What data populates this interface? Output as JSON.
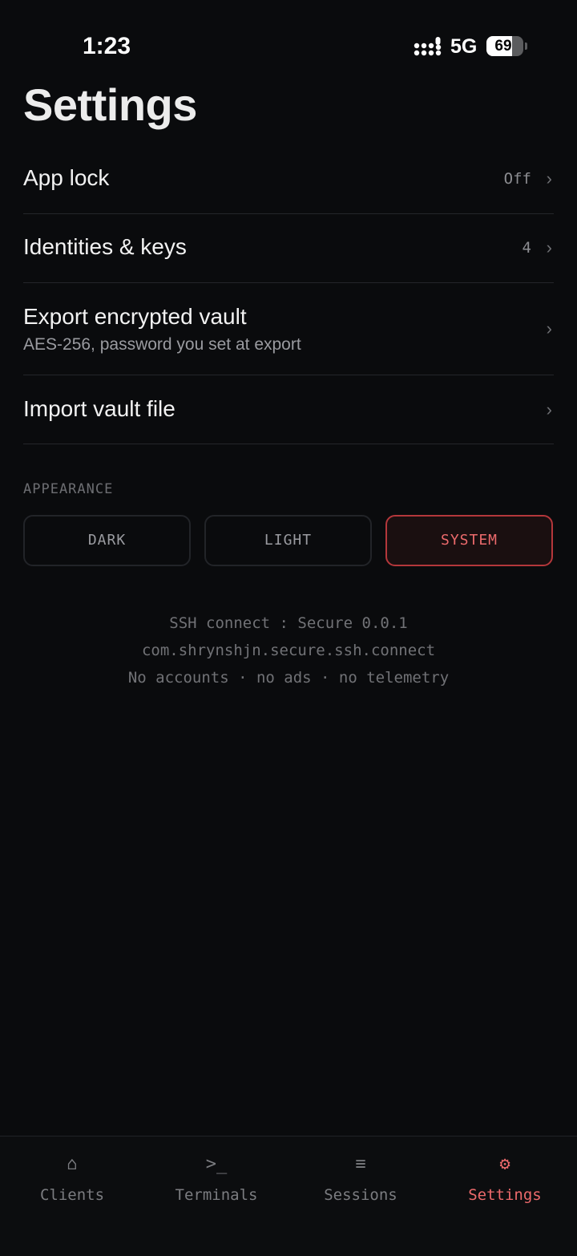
{
  "status_bar": {
    "time": "1:23",
    "network": "5G",
    "battery": "69"
  },
  "page": {
    "title": "Settings"
  },
  "rows": [
    {
      "title": "App lock",
      "value": "Off",
      "icon": "chevron-right-icon"
    },
    {
      "title": "Identities & keys",
      "value": "4",
      "icon": "chevron-right-icon"
    },
    {
      "title": "Export encrypted vault",
      "subtitle": "AES-256, password you set at export",
      "icon": "chevron-right-icon"
    },
    {
      "title": "Import vault file",
      "icon": "chevron-right-icon"
    }
  ],
  "appearance": {
    "label": "APPEARANCE",
    "options": [
      "DARK",
      "LIGHT",
      "SYSTEM"
    ],
    "selected": "SYSTEM"
  },
  "about": {
    "line1": "SSH connect : Secure 0.0.1",
    "line2": "com.shrynshjn.secure.ssh.connect",
    "line3": "No accounts · no ads · no telemetry"
  },
  "tabs": [
    {
      "label": "Clients",
      "icon": "⌂",
      "icon_name": "home-icon"
    },
    {
      "label": "Terminals",
      "icon": ">_",
      "icon_name": "terminal-icon"
    },
    {
      "label": "Sessions",
      "icon": "≡",
      "icon_name": "list-icon"
    },
    {
      "label": "Settings",
      "icon": "⚙",
      "icon_name": "gear-icon",
      "active": true
    }
  ],
  "colors": {
    "accent": "#ec6a6c",
    "accent_border": "#b4373b",
    "background": "#0a0b0d"
  }
}
